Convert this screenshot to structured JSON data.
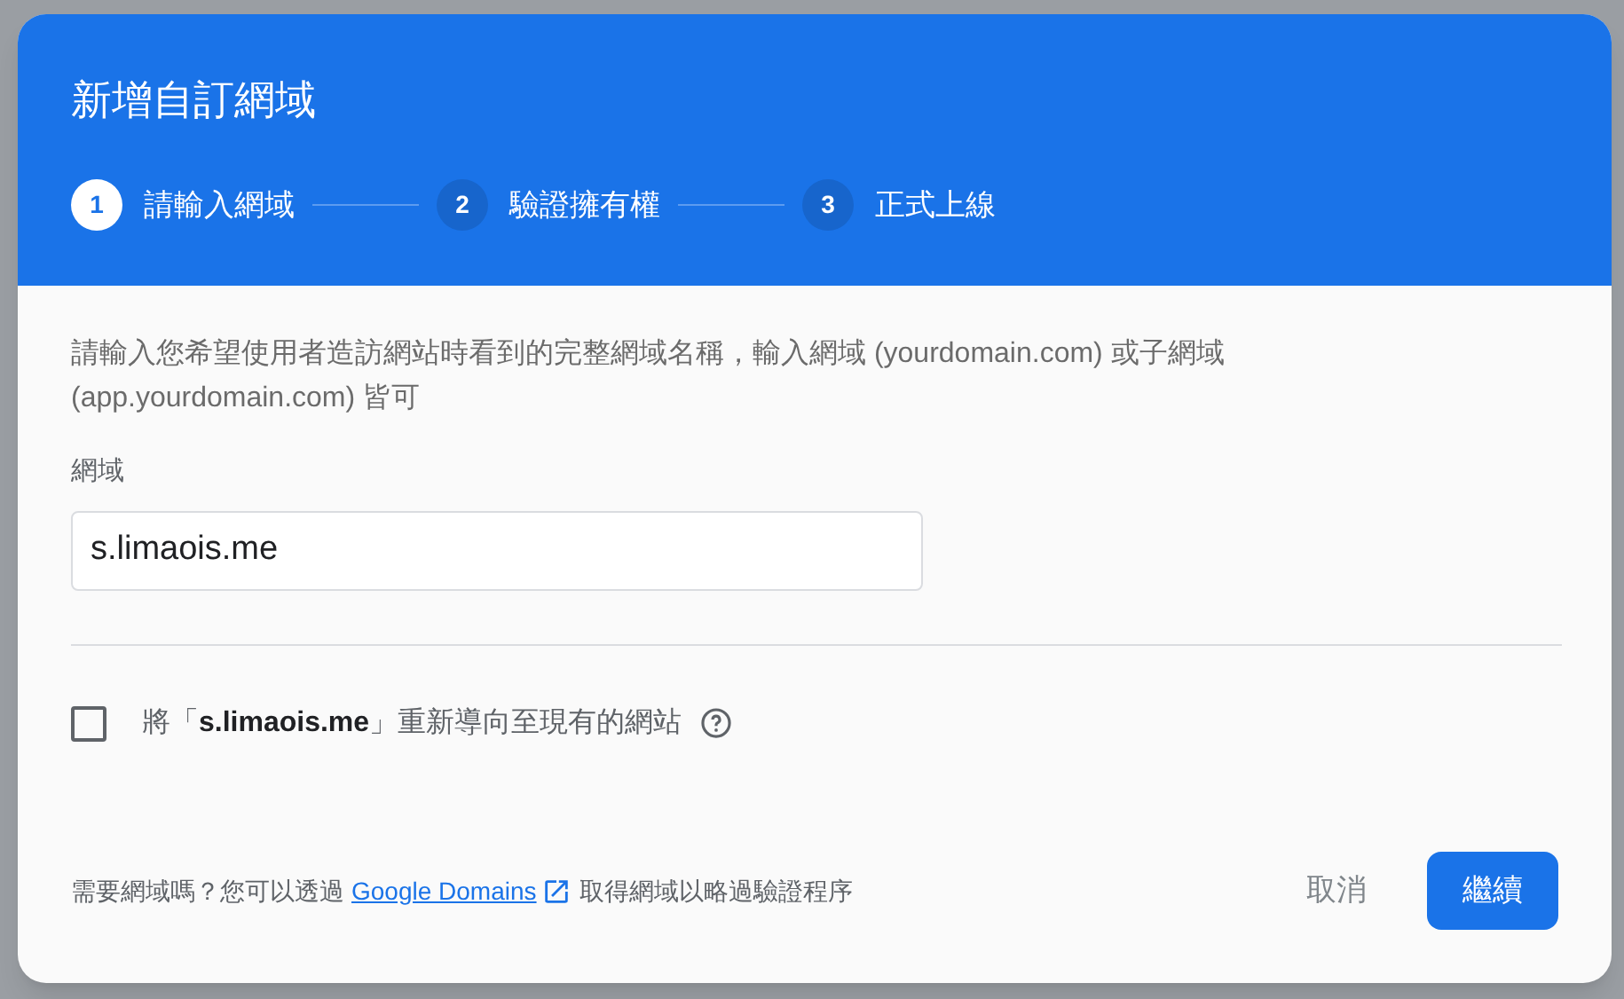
{
  "dialog": {
    "title": "新增自訂網域",
    "steps": [
      {
        "number": "1",
        "label": "請輸入網域",
        "selected": true
      },
      {
        "number": "2",
        "label": "驗證擁有權",
        "selected": false
      },
      {
        "number": "3",
        "label": "正式上線",
        "selected": false
      }
    ],
    "description": "請輸入您希望使用者造訪網站時看到的完整網域名稱，輸入網域 (yourdomain.com) 或子網域 (app.yourdomain.com) 皆可",
    "field": {
      "label": "網域",
      "value": "s.limaois.me"
    },
    "redirect": {
      "text": "將「**s.limaois.me**」重新導向至現有的網站",
      "checked": false
    },
    "footer": {
      "before": "需要網域嗎？您可以透過",
      "link": "Google Domains",
      "after": "取得網域以略過驗證程序"
    },
    "buttons": [
      {
        "label": "取消",
        "kind": "text"
      },
      {
        "label": "繼續",
        "kind": "primary"
      }
    ]
  }
}
